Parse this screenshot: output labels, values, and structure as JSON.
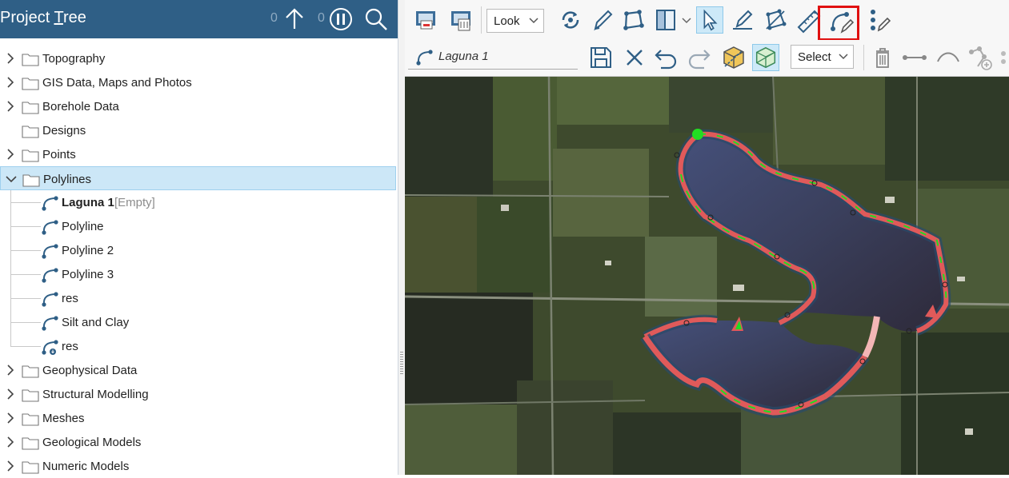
{
  "project_tree": {
    "title_prefix": "Project ",
    "title_underlined": "T",
    "title_suffix": "ree",
    "count_left": "0",
    "count_right": "0",
    "items": [
      {
        "label": "Topography"
      },
      {
        "label": "GIS Data, Maps and Photos"
      },
      {
        "label": "Borehole Data"
      },
      {
        "label": "Designs"
      },
      {
        "label": "Points"
      },
      {
        "label": "Polylines"
      },
      {
        "label": "Laguna 1",
        "note": "[Empty]"
      },
      {
        "label": "Polyline"
      },
      {
        "label": "Polyline 2"
      },
      {
        "label": "Polyline 3"
      },
      {
        "label": "res"
      },
      {
        "label": "Silt and Clay"
      },
      {
        "label": "res"
      },
      {
        "label": "Geophysical Data"
      },
      {
        "label": "Structural Modelling"
      },
      {
        "label": "Meshes"
      },
      {
        "label": "Geological Models"
      },
      {
        "label": "Numeric Models"
      }
    ]
  },
  "toolbar": {
    "look_label": "Look",
    "object_name": "Laguna 1",
    "select_label": "Select"
  },
  "colors": {
    "header_bg": "#2f5f86",
    "selected_row": "#cce7f7",
    "highlight_box": "#e01010",
    "polyline_red": "#e05a5a",
    "polyline_green": "#22dd22"
  }
}
